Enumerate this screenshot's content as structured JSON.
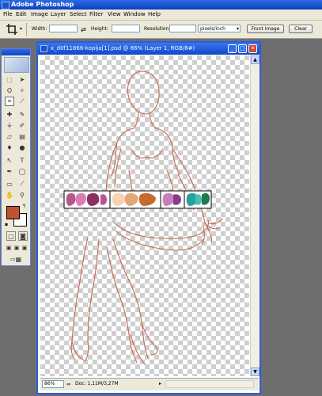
{
  "window": {
    "title": "Adobe Photoshop"
  },
  "menu": [
    "File",
    "Edit",
    "Image",
    "Layer",
    "Select",
    "Filter",
    "View",
    "Window",
    "Help"
  ],
  "options": {
    "width_label": "Width:",
    "height_label": "Height:",
    "resolution_label": "Resolution:",
    "resolution_unit": "pixels/inch",
    "front_image_label": "Front Image",
    "clear_label": "Clear"
  },
  "document": {
    "title": "x_d0f11866-kopija[1].psd @ 86% (Layer 1, RGB/8#)",
    "zoom": "86%",
    "doc_info": "Doc: 1,11M/3,27M"
  },
  "colors": {
    "foreground": "#c0522f",
    "background": "#ffffff",
    "outline": "#c86a4e",
    "palette": [
      "#b8578f",
      "#d77fb4",
      "#8e2f62",
      "#f6d3b3",
      "#e3a878",
      "#c86a2c",
      "#c97fb9",
      "#8a3d8a",
      "#2aa19a",
      "#46c3b5",
      "#1f7a4e"
    ]
  },
  "tools": [
    "marquee-icon",
    "move-icon",
    "lasso-icon",
    "magic-wand-icon",
    "crop-icon",
    "slice-icon",
    "healing-icon",
    "brush-icon",
    "stamp-icon",
    "history-brush-icon",
    "eraser-icon",
    "gradient-icon",
    "blur-icon",
    "dodge-icon",
    "path-select-icon",
    "type-icon",
    "pen-icon",
    "shape-icon",
    "notes-icon",
    "eyedropper-icon",
    "hand-icon",
    "zoom-icon"
  ]
}
